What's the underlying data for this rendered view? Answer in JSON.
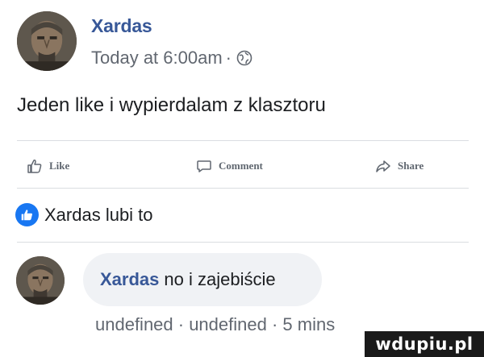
{
  "post": {
    "author": "Xardas",
    "timestamp": "Today at 6:00am",
    "separator": "·",
    "privacy_icon": "globe-icon",
    "text": "Jeden like i wypierdalam z klasztoru"
  },
  "actions": {
    "like_label": "Like",
    "comment_label": "Comment",
    "share_label": "Share"
  },
  "likes": {
    "text": "Xardas lubi to",
    "icon": "thumbs-up-icon",
    "badge_color": "#1877f2"
  },
  "comment": {
    "author": "Xardas",
    "text": "no i zajebiście",
    "meta": "undefined · undefined · 5 mins"
  },
  "watermark": {
    "text": "wdupiu.pl"
  },
  "colors": {
    "name": "#385898",
    "meta": "#616770",
    "bubble": "#f0f2f5",
    "divider": "#dadde1"
  }
}
